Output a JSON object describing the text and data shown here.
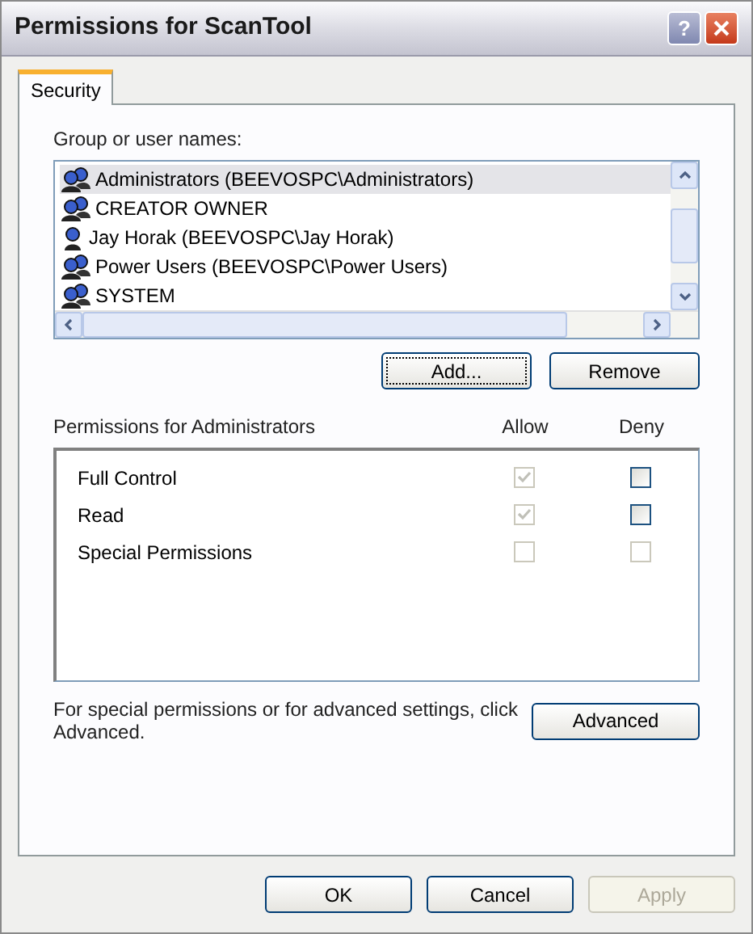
{
  "window": {
    "title": "Permissions for ScanTool",
    "help_glyph": "?"
  },
  "tabs": [
    {
      "label": "Security",
      "selected": true
    }
  ],
  "group_label": "Group or user names:",
  "users": [
    {
      "name": "Administrators (BEEVOSPC\\Administrators)",
      "kind": "group",
      "selected": true
    },
    {
      "name": "CREATOR OWNER",
      "kind": "group",
      "selected": false
    },
    {
      "name": "Jay Horak (BEEVOSPC\\Jay Horak)",
      "kind": "user",
      "selected": false
    },
    {
      "name": "Power Users (BEEVOSPC\\Power Users)",
      "kind": "group",
      "selected": false
    },
    {
      "name": "SYSTEM",
      "kind": "group",
      "selected": false
    }
  ],
  "user_buttons": [
    {
      "label": "Add...",
      "focused": true
    },
    {
      "label": "Remove",
      "focused": false
    }
  ],
  "permissions_label": "Permissions for Administrators",
  "columns": [
    "Allow",
    "Deny"
  ],
  "permissions": [
    {
      "name": "Full Control",
      "allow": {
        "checked": true,
        "disabled": true
      },
      "deny": {
        "checked": false,
        "disabled": false
      }
    },
    {
      "name": "Read",
      "allow": {
        "checked": true,
        "disabled": true
      },
      "deny": {
        "checked": false,
        "disabled": false
      }
    },
    {
      "name": "Special Permissions",
      "allow": {
        "checked": false,
        "disabled": true
      },
      "deny": {
        "checked": false,
        "disabled": true
      }
    }
  ],
  "advanced_note": "For special permissions or for advanced settings, click Advanced.",
  "advanced_button": "Advanced",
  "footer_buttons": [
    {
      "label": "OK",
      "disabled": false
    },
    {
      "label": "Cancel",
      "disabled": false
    },
    {
      "label": "Apply",
      "disabled": true
    }
  ]
}
